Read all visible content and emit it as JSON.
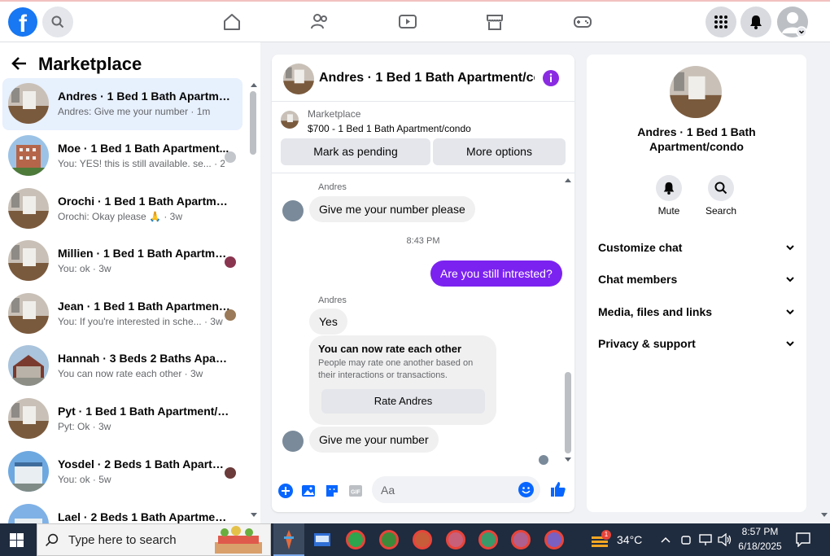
{
  "header": {
    "logo_letter": "f",
    "avatar_icon": "profile-avatar-icon"
  },
  "sidebar": {
    "title": "Marketplace",
    "conversations": [
      {
        "name": "Andres · 1 Bed 1 Bath Apartment...",
        "preview": "Andres: Give me your number · 1m",
        "active": true
      },
      {
        "name": "Moe · 1 Bed 1 Bath Apartment...",
        "preview": "You: YES! this is still available. se... · 2w"
      },
      {
        "name": "Orochi · 1 Bed 1 Bath Apartment...",
        "preview": "Orochi: Okay please 🙏 · 3w"
      },
      {
        "name": "Millien · 1 Bed 1 Bath Apartme...",
        "preview": "You: ok · 3w"
      },
      {
        "name": "Jean · 1 Bed 1 Bath Apartment...",
        "preview": "You: If you're interested in sche... · 3w"
      },
      {
        "name": "Hannah · 3 Beds 2 Baths Apart...",
        "preview": "You can now rate each other · 3w"
      },
      {
        "name": "Pyt · 1 Bed 1 Bath Apartment/co...",
        "preview": "Pyt: Ok · 3w"
      },
      {
        "name": "Yosdel · 2 Beds 1 Bath Apartm...",
        "preview": "You: ok · 5w"
      },
      {
        "name": "Lael · 2 Beds 1 Bath Apartment/...",
        "preview": ""
      }
    ]
  },
  "chat": {
    "title": "Andres · 1 Bed 1 Bath Apartment/co...",
    "product_source": "Marketplace",
    "product_title": "$700 - 1 Bed 1 Bath Apartment/condo",
    "mark_pending": "Mark as pending",
    "more_options": "More options",
    "messages": {
      "sender1": "Andres",
      "msg1": "Give me your number please",
      "time": "8:43 PM",
      "msg2": "Are you still intrested?",
      "sender2": "Andres",
      "msg3": "Yes",
      "card_title": "You can now rate each other",
      "card_body": "People may rate one another based on their interactions or transactions.",
      "card_button": "Rate Andres",
      "msg4": "Give me your number"
    },
    "composer_placeholder": "Aa"
  },
  "details": {
    "name": "Andres · 1 Bed 1 Bath Apartment/condo",
    "mute": "Mute",
    "search": "Search",
    "sections": [
      "Customize chat",
      "Chat members",
      "Media, files and links",
      "Privacy & support"
    ]
  },
  "taskbar": {
    "search_placeholder": "Type here to search",
    "weather_badge": "1",
    "temperature": "34°C",
    "time": "8:57 PM",
    "date": "6/18/2025"
  },
  "colors": {
    "brand": "#1877f2",
    "my_bubble": "#7b22f0",
    "active_row": "#e7f0fd"
  }
}
